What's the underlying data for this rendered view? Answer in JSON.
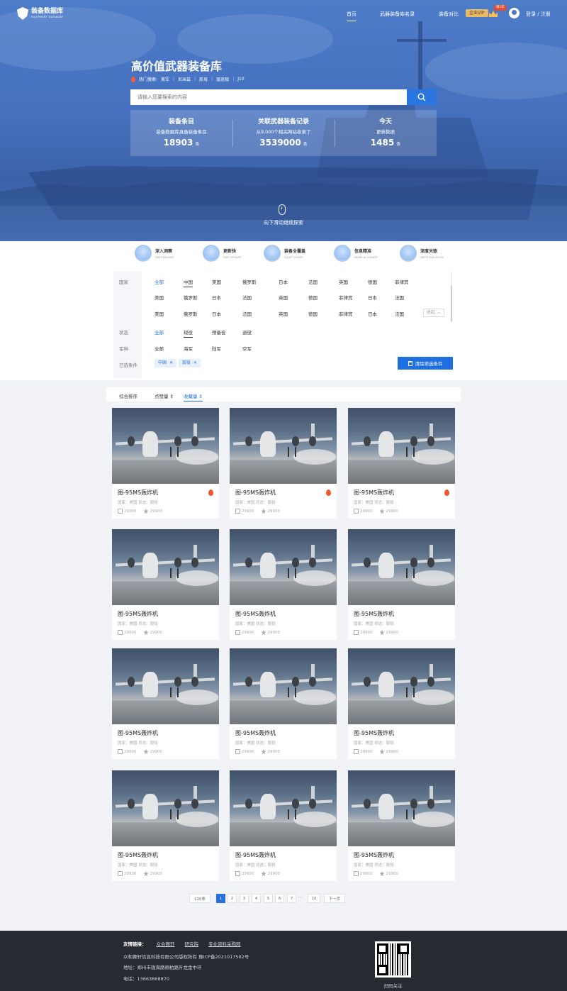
{
  "brand": {
    "name": "装备数据库",
    "subtitle": "EQUIPMENT DATABASE"
  },
  "nav": {
    "items": [
      "首页",
      "武器装备库名录",
      "装备对比"
    ],
    "vip_label": "企业VIP",
    "vip_badge": "限1年",
    "login": "登录 / 注册"
  },
  "hero": {
    "title": "高价值武器装备库",
    "hot_label": "热门搜索:",
    "hot_terms": [
      "美军",
      "尼米兹",
      "航母",
      "驱逐舰",
      "J10"
    ],
    "search_placeholder": "请输入您要搜索的内容",
    "stats": [
      {
        "title": "装备条目",
        "subtitle": "装备数据库具备装备条目",
        "value": "18903",
        "unit": "条"
      },
      {
        "title": "关联武器装备记录",
        "subtitle": "从9,000个相关网站收录了",
        "value": "3539000",
        "unit": "条"
      },
      {
        "title": "今天",
        "subtitle": "更新数据",
        "value": "1485",
        "unit": "条"
      }
    ],
    "scroll_tip": "向下滑动继续探索"
  },
  "features": [
    {
      "title": "深入洞察",
      "en": "DEEP INSIGHT"
    },
    {
      "title": "更新快",
      "en": "FAST UPDATE"
    },
    {
      "title": "装备全覆盖",
      "en": "EQUIP COVER"
    },
    {
      "title": "信息精准",
      "en": "NEWS ACCURATE"
    },
    {
      "title": "深度关联",
      "en": "DEPTH RELATION"
    }
  ],
  "filter": {
    "country_label": "国家",
    "country_rows": [
      [
        "全部",
        "中国",
        "美国",
        "俄罗斯",
        "日本",
        "法国",
        "英国",
        "德国",
        "菲律宾"
      ],
      [
        "美国",
        "俄罗斯",
        "日本",
        "法国",
        "英国",
        "德国",
        "菲律宾",
        "日本",
        "法国"
      ],
      [
        "美国",
        "俄罗斯",
        "日本",
        "法国",
        "英国",
        "德国",
        "菲律宾",
        "日本",
        "法国"
      ]
    ],
    "collapse_label": "收起",
    "status_label": "状态",
    "status_options": [
      "全部",
      "现役",
      "预备役",
      "退役"
    ],
    "branch_label": "军种",
    "branch_options": [
      "全部",
      "海军",
      "陆军",
      "空军"
    ],
    "selected_label": "已选条件",
    "selected_chips": [
      "中国",
      "现役"
    ],
    "clear_button": "清除筛选条件"
  },
  "sort": [
    "综合排序",
    "点赞量",
    "收藏量"
  ],
  "cards": {
    "title": "图-95MS轰炸机",
    "meta": "国家：美国    状态：服役",
    "likes": "29900",
    "favs": "29900",
    "count": 12,
    "hot_rows": 1
  },
  "pagination": {
    "total": "120条",
    "pages": [
      "1",
      "2",
      "3",
      "4",
      "5",
      "6",
      "7"
    ],
    "dots": "···",
    "last": "10",
    "next": "下一页",
    "current": "1"
  },
  "footer": {
    "links_label": "友情链接：",
    "links": [
      "众合赛轩",
      "研究院",
      "专业资料采购网"
    ],
    "copyright": "众和赛轩信息科技有限公司版权所有  豫ICP备2021017582号",
    "address": "地址：郑州市陇海路桐柏路升龙金中环",
    "phone": "电话：13663868870",
    "qr_caption": "扫码关注"
  },
  "colors": {
    "primary": "#2a6fde",
    "hero": "#4a78c4",
    "footer": "#272a31",
    "hot": "#f1582d"
  }
}
